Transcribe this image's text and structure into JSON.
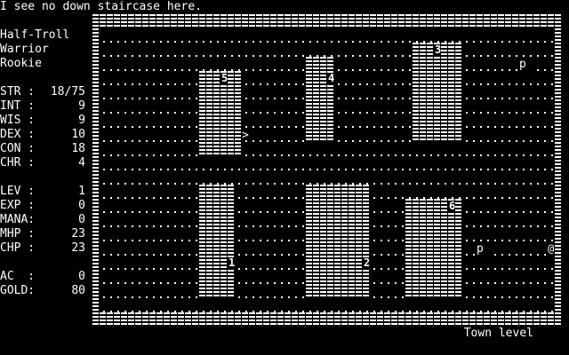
{
  "message": "I see no down staircase here.",
  "character": {
    "name": "Half-Troll",
    "class": "Warrior",
    "title": "Rookie"
  },
  "stats": [
    {
      "label": "STR :",
      "value": "18/75"
    },
    {
      "label": "INT :",
      "value": "9"
    },
    {
      "label": "WIS :",
      "value": "9"
    },
    {
      "label": "DEX :",
      "value": "10"
    },
    {
      "label": "CON :",
      "value": "18"
    },
    {
      "label": "CHR :",
      "value": "4"
    }
  ],
  "status": [
    {
      "label": "LEV :",
      "value": "1"
    },
    {
      "label": "EXP :",
      "value": "0"
    },
    {
      "label": "MANA:",
      "value": "0"
    },
    {
      "label": "MHP :",
      "value": "23"
    },
    {
      "label": "CHP :",
      "value": "23"
    }
  ],
  "misc": [
    {
      "label": "AC  :",
      "value": "0"
    },
    {
      "label": "GOLD:",
      "value": "80"
    }
  ],
  "map_location": "Town level",
  "map": {
    "shops": [
      {
        "number": "1"
      },
      {
        "number": "2"
      },
      {
        "number": "3"
      },
      {
        "number": "4"
      },
      {
        "number": "5"
      },
      {
        "number": "6"
      }
    ],
    "player_glyph": "@",
    "townsperson_glyph": "p",
    "stair_glyph": ">",
    "floor_glyph": "."
  }
}
